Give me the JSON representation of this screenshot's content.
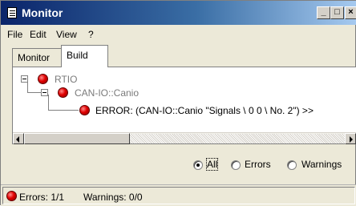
{
  "window": {
    "title": "Monitor",
    "title_icon": "document-icon",
    "controls": {
      "minimize": "_",
      "maximize": "□",
      "close": "×"
    }
  },
  "menu": [
    "File",
    "Edit",
    "View",
    "?"
  ],
  "tabs": [
    {
      "label": "Monitor",
      "active": false
    },
    {
      "label": "Build",
      "active": true
    }
  ],
  "tree": {
    "root": {
      "label": "RTIO",
      "status": "error",
      "expanded": true
    },
    "child": {
      "label": "CAN-IO::Canio",
      "status": "error",
      "expanded": true
    },
    "leaf": {
      "label": "ERROR: (CAN-IO::Canio \"Signals \\ 0 0 \\ No. 2\") >>",
      "status": "error"
    }
  },
  "filters": [
    {
      "label": "All",
      "checked": true
    },
    {
      "label": "Errors",
      "checked": false
    },
    {
      "label": "Warnings",
      "checked": false
    }
  ],
  "status": {
    "errors": "Errors: 1/1",
    "warnings": "Warnings: 0/0"
  },
  "colors": {
    "error_led": "#e00000",
    "title_bar": "#0a246a"
  }
}
